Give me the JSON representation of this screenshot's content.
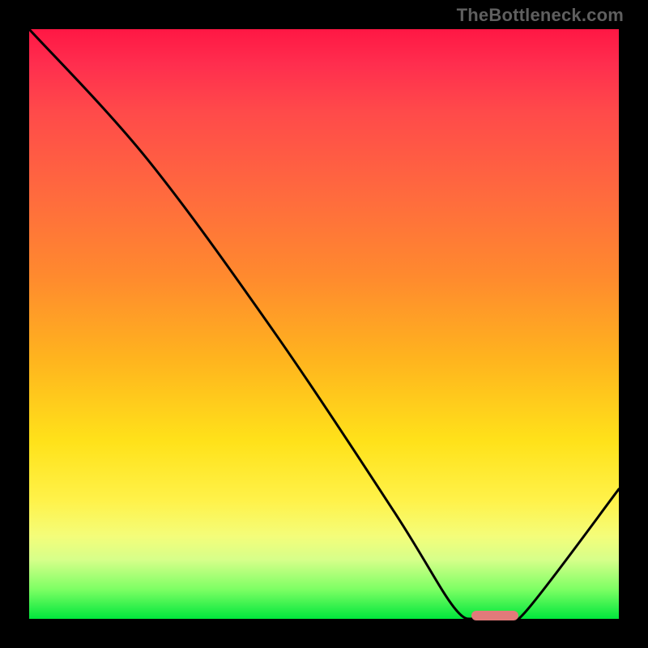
{
  "watermark": "TheBottleneck.com",
  "colors": {
    "background": "#000000",
    "curve_stroke": "#000000",
    "marker_fill": "#e27a7a",
    "gradient_top": "#ff1744",
    "gradient_bottom": "#00e63c"
  },
  "chart_data": {
    "type": "line",
    "title": "",
    "xlabel": "",
    "ylabel": "",
    "xlim": [
      0,
      100
    ],
    "ylim": [
      0,
      100
    ],
    "grid": false,
    "legend": false,
    "series": [
      {
        "name": "bottleneck-curve",
        "x": [
          0,
          20,
          42,
          62,
          72,
          76,
          80,
          84,
          100
        ],
        "values": [
          100,
          78,
          48,
          18,
          2,
          0,
          0,
          1,
          22
        ]
      }
    ],
    "marker": {
      "name": "optimal-segment",
      "x_start": 75,
      "x_end": 83,
      "y": 0
    }
  }
}
